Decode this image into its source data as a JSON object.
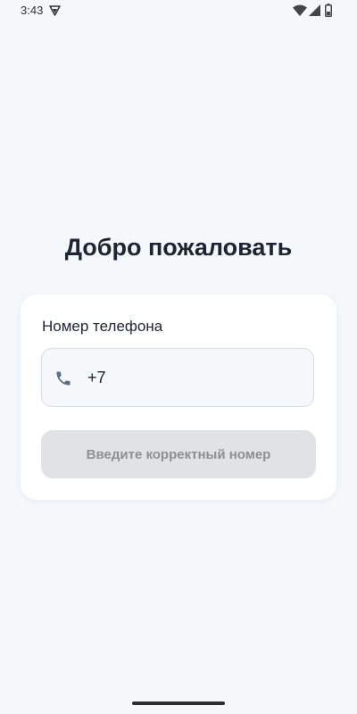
{
  "status_bar": {
    "time": "3:43",
    "icons": [
      "vpn-icon",
      "wifi-icon",
      "cell-signal-icon",
      "battery-icon"
    ]
  },
  "welcome": {
    "title": "Добро пожаловать"
  },
  "login_card": {
    "phone_label": "Номер телефона",
    "phone_value": "+7",
    "phone_icon": "phone-icon",
    "submit_label": "Введите корректный номер",
    "submit_disabled": true
  },
  "colors": {
    "background": "#F4F8FB",
    "card": "#FFFFFF",
    "text_primary": "#1D2433",
    "icon": "#5C6F82",
    "button_disabled_bg": "#E1E2E4",
    "button_disabled_text": "#8D8F93"
  }
}
